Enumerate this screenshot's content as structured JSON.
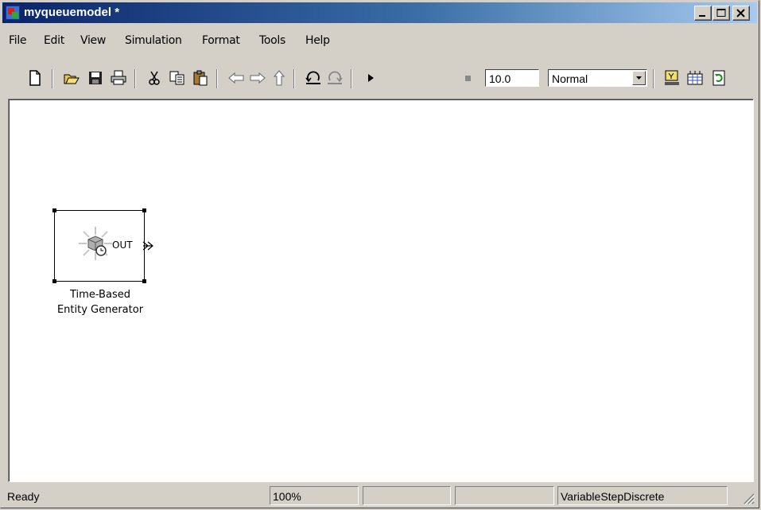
{
  "window": {
    "title": "myqueuemodel *",
    "icon": "simulink-model-icon"
  },
  "caption_buttons": {
    "minimize_icon": "minimize-icon",
    "maximize_icon": "maximize-icon",
    "close_icon": "close-icon"
  },
  "menu": {
    "items": [
      "File",
      "Edit",
      "View",
      "Simulation",
      "Format",
      "Tools",
      "Help"
    ]
  },
  "toolbar": {
    "icons": [
      "new-icon",
      "open-icon",
      "save-icon",
      "print-icon",
      "cut-icon",
      "copy-icon",
      "paste-icon",
      "back-icon",
      "forward-icon",
      "up-icon",
      "undo-icon",
      "redo-icon",
      "start-simulation-icon",
      "stop-simulation-icon",
      "build-icon",
      "library-browser-icon",
      "refresh-icon"
    ],
    "stop_time": "10.0",
    "simulation_mode": "Normal"
  },
  "canvas": {
    "block": {
      "port_label": "OUT",
      "label_line1": "Time-Based",
      "label_line2": "Entity Generator",
      "icon": "entity-generator-icon"
    }
  },
  "status": {
    "state": "Ready",
    "zoom": "100%",
    "pane3": "",
    "pane4": "",
    "solver": "VariableStepDiscrete"
  }
}
